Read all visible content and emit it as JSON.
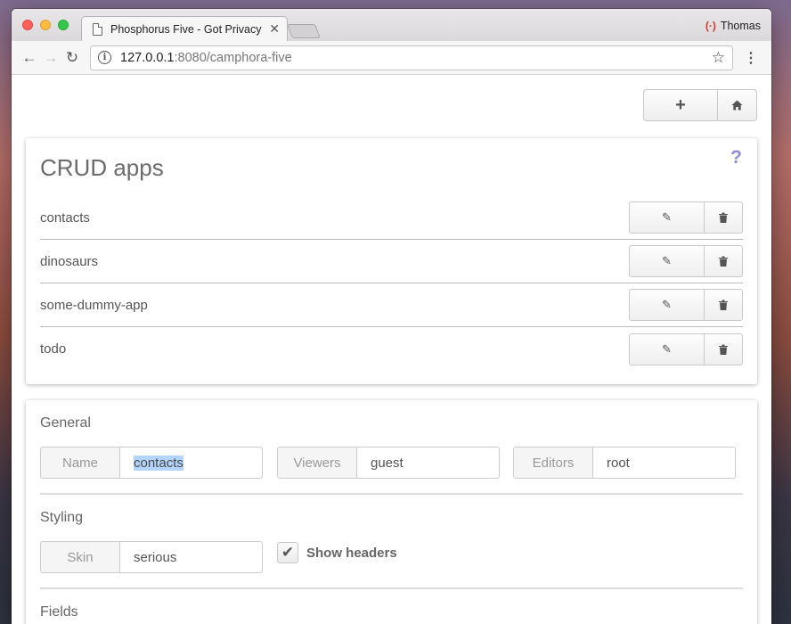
{
  "browser": {
    "tab_title": "Phosphorus Five - Got Privacy",
    "tab_close": "✕",
    "profile_name": "Thomas",
    "url_host": "127.0.0.1",
    "url_rest": ":8080/camphora-five"
  },
  "toolbar": {
    "back_icon": "←",
    "forward_icon": "→",
    "reload_icon": "↻",
    "info_icon": "i",
    "star_icon": "☆",
    "menu_icon": "⋮"
  },
  "actions": {
    "add_icon": "+",
    "home_icon": "⌂"
  },
  "apps": {
    "title": "CRUD apps",
    "help_icon": "?",
    "items": [
      {
        "name": "contacts"
      },
      {
        "name": "dinosaurs"
      },
      {
        "name": "some-dummy-app"
      },
      {
        "name": "todo"
      }
    ],
    "edit_icon": "✎",
    "delete_icon": "🗑"
  },
  "settings": {
    "general_title": "General",
    "name_label": "Name",
    "name_value": "contacts",
    "viewers_label": "Viewers",
    "viewers_value": "guest",
    "editors_label": "Editors",
    "editors_value": "root",
    "styling_title": "Styling",
    "skin_label": "Skin",
    "skin_value": "serious",
    "show_headers_label": "Show headers",
    "show_headers_checked": true,
    "check_icon": "✔",
    "fields_title": "Fields"
  },
  "colors": {
    "help_icon": "#8e8ed6",
    "selection": "#b3d4fd"
  }
}
